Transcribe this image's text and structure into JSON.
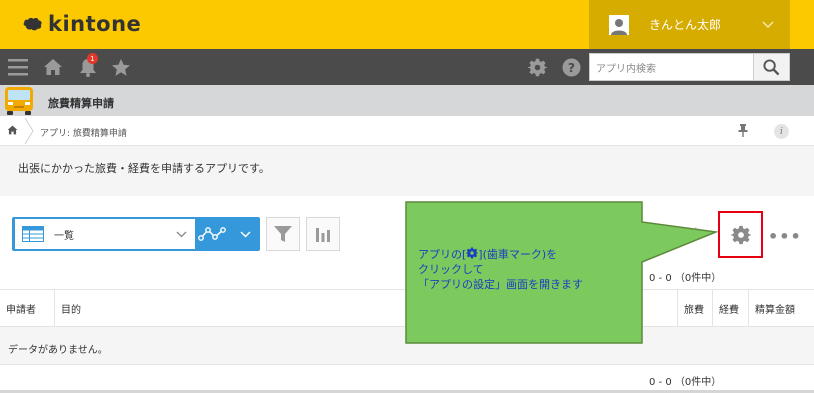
{
  "header": {
    "logo_text": "kintone",
    "user_name": "きんとん太郎"
  },
  "navbar": {
    "notification_count": "1",
    "search_placeholder": "アプリ内検索"
  },
  "app": {
    "title": "旅費精算申請",
    "breadcrumb": "アプリ: 旅費精算申請",
    "description": "出張にかかった旅費・経費を申請するアプリです。"
  },
  "toolbar": {
    "view_name": "一覧",
    "record_count": "0 - 0 （0件中）"
  },
  "table": {
    "columns": [
      "申請者",
      "目的",
      "旅費",
      "経費",
      "精算金額"
    ],
    "empty_message": "データがありません。",
    "record_count_bottom": "0 - 0 （0件中）"
  },
  "callout": {
    "line1_prefix": "アプリの[",
    "line1_suffix": "](歯車マーク)を",
    "line2": "クリックして",
    "line3": "「アプリの設定」画面を開きます"
  },
  "colors": {
    "brand_yellow": "#fcc800",
    "nav_dark": "#4b4b4b",
    "view_blue": "#3498db",
    "highlight_red": "#e60012",
    "callout_green": "#7cc95e",
    "callout_text": "#1a3fc1"
  },
  "icons": [
    "kintone-logo-icon",
    "user-avatar-icon",
    "chevron-down-icon",
    "menu-icon",
    "home-icon",
    "bell-icon",
    "star-icon",
    "gear-icon",
    "help-icon",
    "search-icon",
    "app-bus-icon",
    "pin-icon",
    "info-icon",
    "table-view-icon",
    "graph-icon",
    "filter-icon",
    "chart-icon",
    "more-icon"
  ]
}
